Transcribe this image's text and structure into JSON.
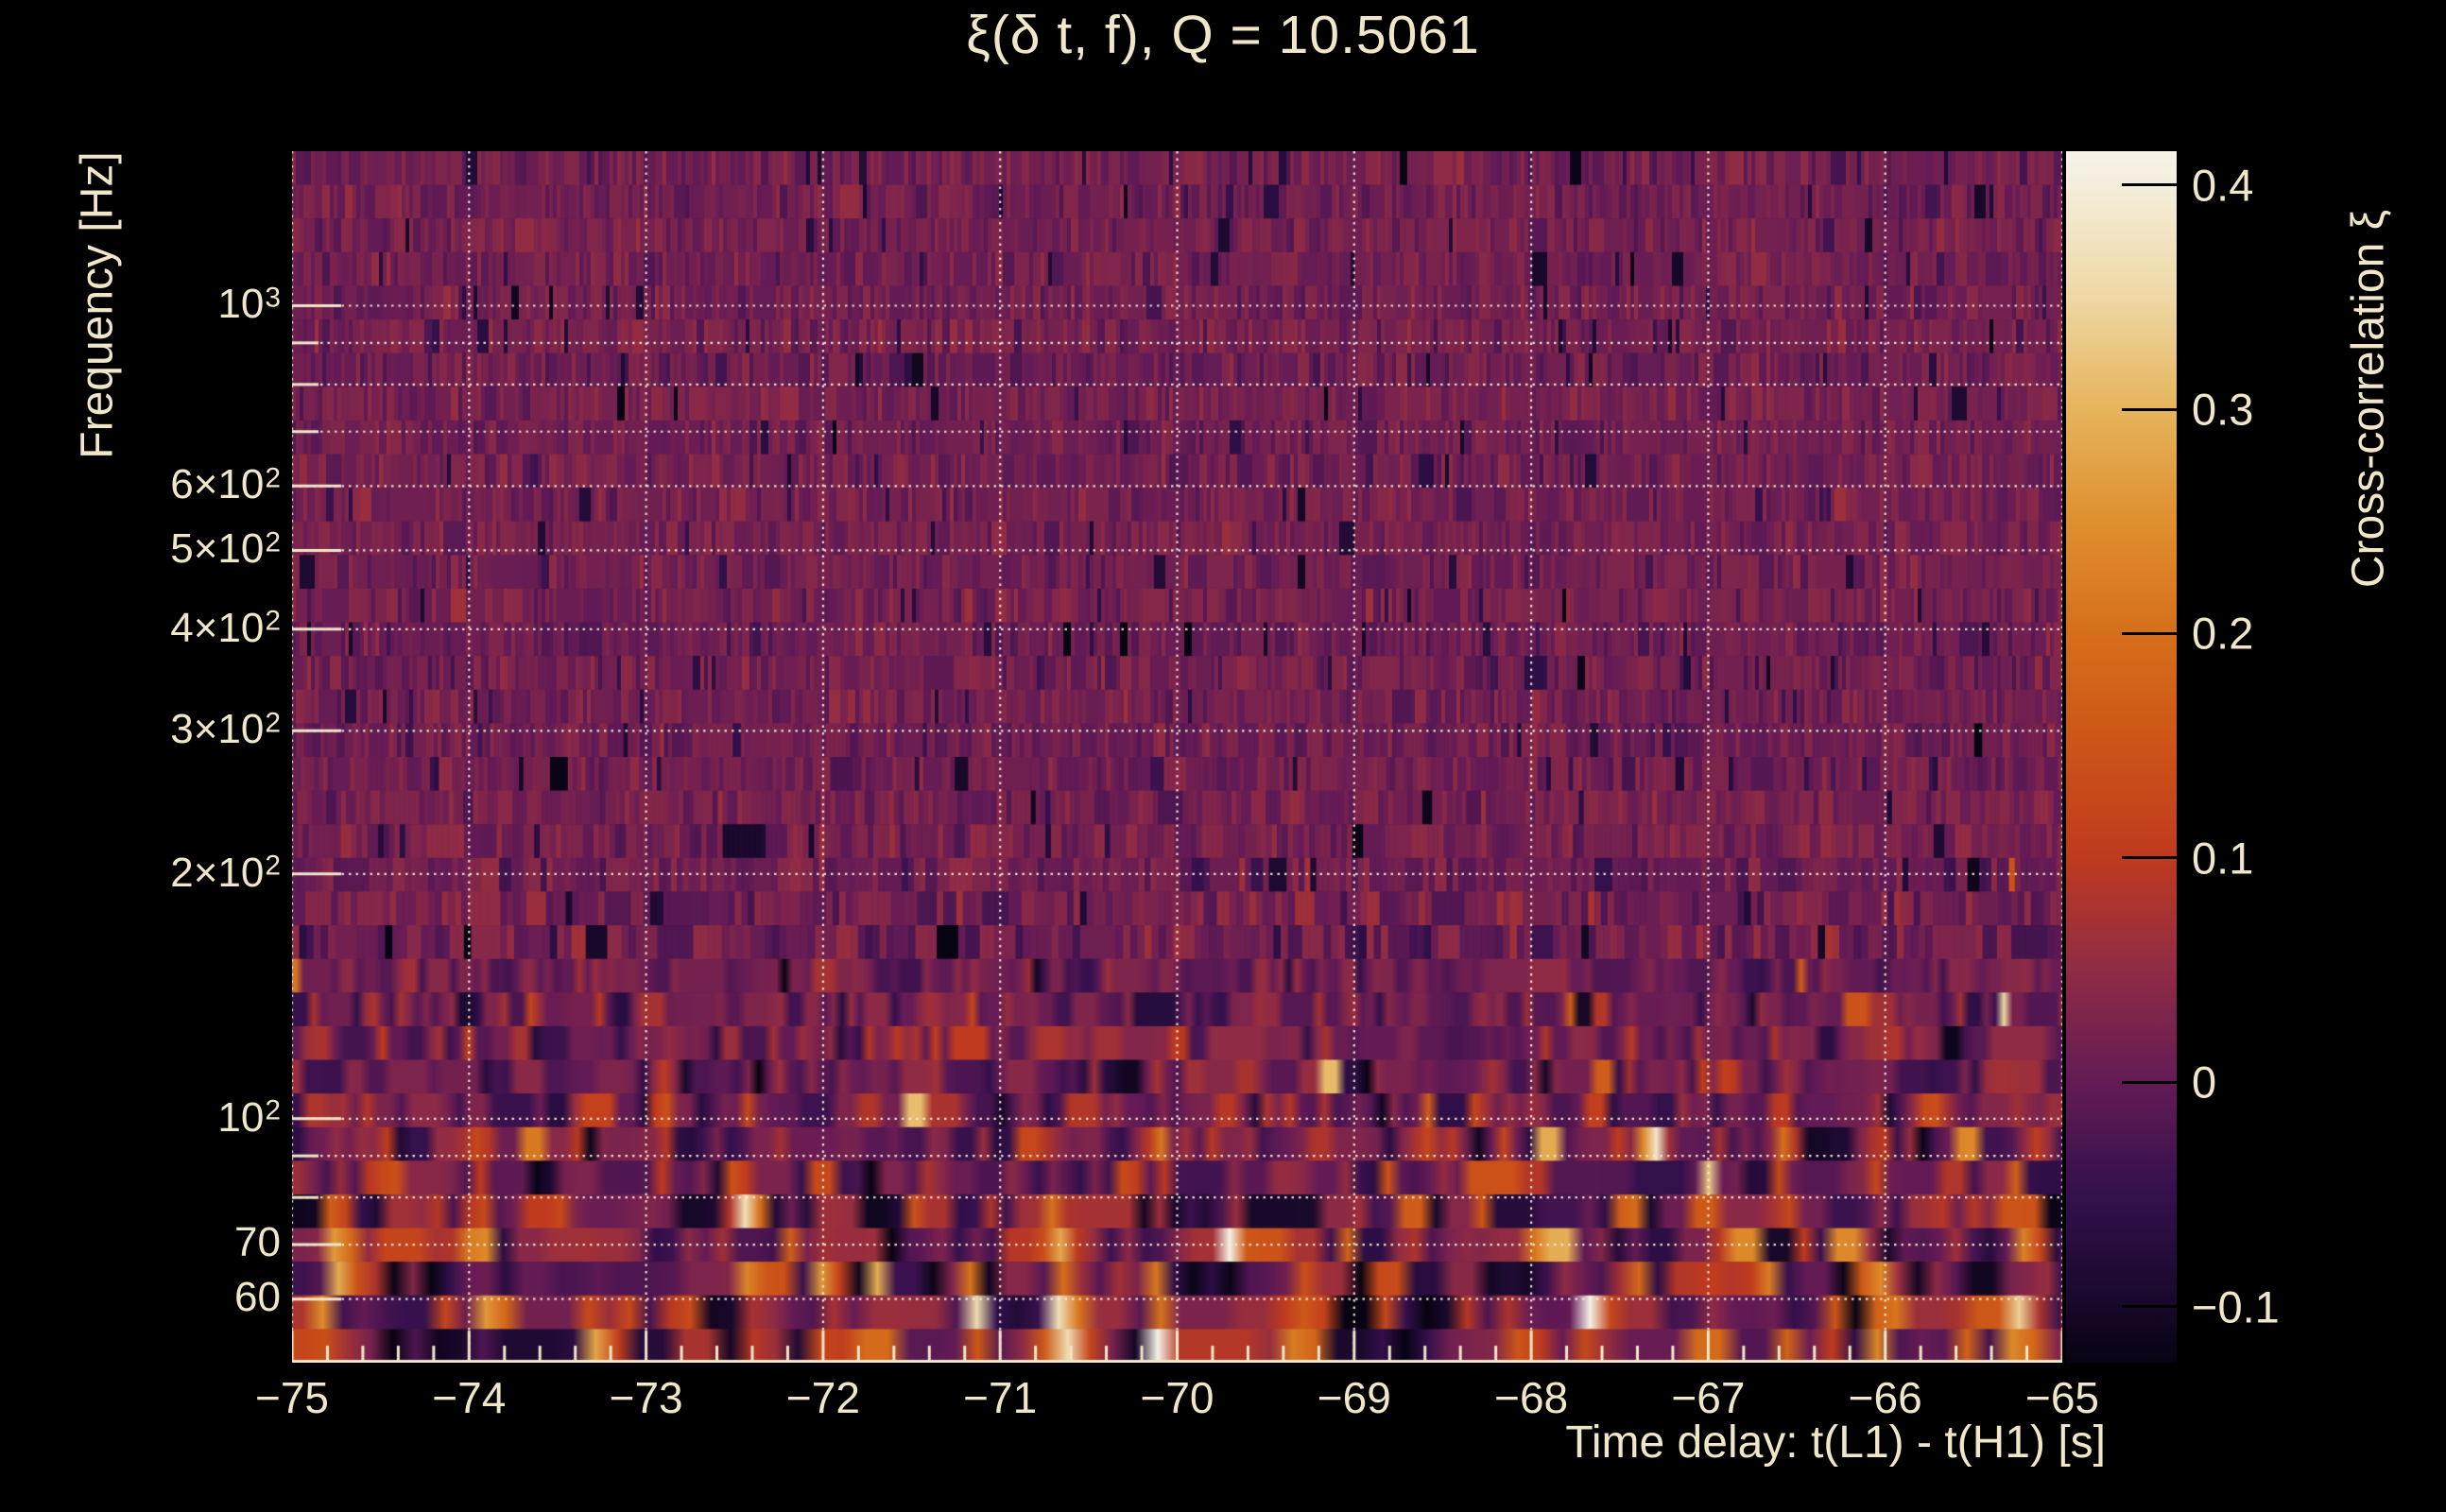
{
  "title": "ξ(δ t, f), Q = 10.5061",
  "colors": {
    "background": "#000000",
    "text": "#efe7c8",
    "grid": "#f5eed8",
    "axis": "#efe7c8",
    "colorbar_tick": "#000000"
  },
  "axes": {
    "x": {
      "label": "Time delay: t(L1) - t(H1) [s]",
      "min": -75,
      "max": -65,
      "major_tick_values": [
        -75,
        -74,
        -73,
        -72,
        -71,
        -70,
        -69,
        -68,
        -67,
        -66,
        -65
      ],
      "major_tick_labels": [
        "−75",
        "−74",
        "−73",
        "−72",
        "−71",
        "−70",
        "−69",
        "−68",
        "−67",
        "−66",
        "−65"
      ],
      "minor_step": 0.2
    },
    "y": {
      "label": "Frequency [Hz]",
      "scale": "log",
      "min_hz": 50.1,
      "max_hz": 1549,
      "ticks": [
        {
          "value": 1000,
          "base": "10",
          "exp": "3"
        },
        {
          "value": 600,
          "base": "6×10",
          "exp": "2"
        },
        {
          "value": 500,
          "base": "5×10",
          "exp": "2"
        },
        {
          "value": 400,
          "base": "4×10",
          "exp": "2"
        },
        {
          "value": 300,
          "base": "3×10",
          "exp": "2"
        },
        {
          "value": 200,
          "base": "2×10",
          "exp": "2"
        },
        {
          "value": 100,
          "base": "10",
          "exp": "2"
        },
        {
          "value": 70,
          "base": "70",
          "exp": ""
        },
        {
          "value": 60,
          "base": "60",
          "exp": ""
        }
      ],
      "minor_tick_values": [
        900,
        800,
        700,
        90,
        80
      ],
      "grid_values": [
        60,
        70,
        80,
        90,
        100,
        200,
        300,
        400,
        500,
        600,
        700,
        800,
        900,
        1000
      ]
    }
  },
  "colorbar": {
    "label": "Cross-correlation ξ",
    "min": -0.125,
    "max": 0.415,
    "tick_values": [
      0.4,
      0.3,
      0.2,
      0.1,
      0,
      -0.1
    ],
    "tick_labels": [
      "0.4",
      "0.3",
      "0.2",
      "0.1",
      "0",
      "−0.1"
    ],
    "colormap": [
      [
        -0.125,
        "#070312"
      ],
      [
        -0.1,
        "#170829"
      ],
      [
        -0.05,
        "#33104c"
      ],
      [
        0.0,
        "#641b55"
      ],
      [
        0.05,
        "#8f2b45"
      ],
      [
        0.1,
        "#bf3a1e"
      ],
      [
        0.15,
        "#cc5418"
      ],
      [
        0.2,
        "#d66f1a"
      ],
      [
        0.25,
        "#df8f2e"
      ],
      [
        0.3,
        "#e6b45c"
      ],
      [
        0.35,
        "#eed8a4"
      ],
      [
        0.4,
        "#f4eedb"
      ],
      [
        0.415,
        "#f6f2e8"
      ]
    ]
  },
  "chart_data": {
    "type": "heatmap",
    "title": "ξ(δ t, f), Q = 10.5061",
    "q_value": 10.5061,
    "xlabel": "Time delay: t(L1) - t(H1) [s]",
    "ylabel": "Frequency [Hz]",
    "zlabel": "Cross-correlation ξ",
    "x_range": [
      -75,
      -65
    ],
    "y_range_hz": [
      50.1,
      1549
    ],
    "y_scale": "log",
    "z_range": [
      -0.125,
      0.415
    ],
    "grid": true,
    "legend_position": "colorbar-right",
    "noise_model": {
      "background_mean_xi": 0.015,
      "sigma_high_freq": 0.022,
      "sigma_low_freq": 0.095,
      "low_freq_transition_hz": 240,
      "tile_rows": 36,
      "tile_width_seconds_at_100hz": 0.067
    },
    "hotspots": [
      {
        "t": -70.66,
        "f": 53,
        "xi": 0.44,
        "st": 0.05,
        "sf": 0.05
      },
      {
        "t": -70.68,
        "f": 68,
        "xi": 0.22,
        "st": 0.06,
        "sf": 0.1
      },
      {
        "t": -66.05,
        "f": 60,
        "xi": 0.3,
        "st": 0.05,
        "sf": 0.16
      },
      {
        "t": -74.72,
        "f": 70,
        "xi": 0.26,
        "st": 0.08,
        "sf": 0.1
      },
      {
        "t": -73.95,
        "f": 70,
        "xi": 0.22,
        "st": 0.07,
        "sf": 0.12
      },
      {
        "t": -72.42,
        "f": 54,
        "xi": 0.26,
        "st": 0.07,
        "sf": 0.07
      },
      {
        "t": -71.15,
        "f": 56,
        "xi": 0.22,
        "st": 0.06,
        "sf": 0.08
      },
      {
        "t": -69.3,
        "f": 54,
        "xi": 0.24,
        "st": 0.08,
        "sf": 0.07
      },
      {
        "t": -68.1,
        "f": 52,
        "xi": 0.2,
        "st": 0.06,
        "sf": 0.06
      },
      {
        "t": -67.65,
        "f": 56,
        "xi": 0.22,
        "st": 0.07,
        "sf": 0.08
      },
      {
        "t": -65.25,
        "f": 66,
        "xi": 0.26,
        "st": 0.05,
        "sf": 0.1
      },
      {
        "t": -72.9,
        "f": 95,
        "xi": 0.18,
        "st": 0.05,
        "sf": 0.08
      },
      {
        "t": -70.1,
        "f": 90,
        "xi": 0.16,
        "st": 0.05,
        "sf": 0.08
      },
      {
        "t": -66.6,
        "f": 95,
        "xi": 0.16,
        "st": 0.05,
        "sf": 0.08
      },
      {
        "t": -73.3,
        "f": 52,
        "xi": 0.18,
        "st": 0.06,
        "sf": 0.06
      },
      {
        "t": -67.0,
        "f": 52,
        "xi": 0.18,
        "st": 0.06,
        "sf": 0.06
      }
    ]
  }
}
